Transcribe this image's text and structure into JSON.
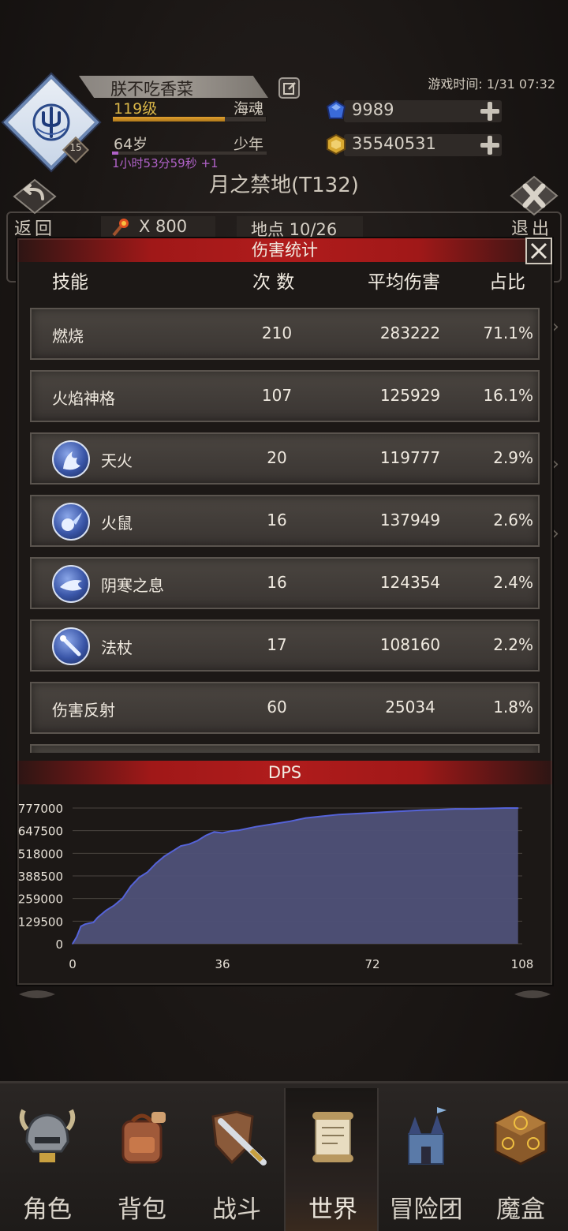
{
  "player": {
    "name": "朕不吃香菜",
    "level": "119级",
    "class": "海魂",
    "age": "64岁",
    "stage": "少年",
    "timer": "1小时53分59秒 +1",
    "rank_badge": "15",
    "exp_progress": 0.73
  },
  "header": {
    "game_time": "游戏时间: 1/31 07:32",
    "gems": "9989",
    "gold": "35540531",
    "map_name": "月之禁地(T132)",
    "back_label": "返回",
    "exit_label": "退出",
    "torch_count": "X 800",
    "location": "地点 10/26"
  },
  "dialog": {
    "title": "伤害统计",
    "columns": {
      "skill": "技能",
      "count": "次 数",
      "avg": "平均伤害",
      "pct": "占比"
    },
    "rows": [
      {
        "name": "燃烧",
        "count": "210",
        "avg": "283222",
        "pct": "71.1%",
        "icon": null
      },
      {
        "name": "火焰神格",
        "count": "107",
        "avg": "125929",
        "pct": "16.1%",
        "icon": null
      },
      {
        "name": "天火",
        "count": "20",
        "avg": "119777",
        "pct": "2.9%",
        "icon": "sky-fire-icon"
      },
      {
        "name": "火鼠",
        "count": "16",
        "avg": "137949",
        "pct": "2.6%",
        "icon": "fire-rat-icon"
      },
      {
        "name": "阴寒之息",
        "count": "16",
        "avg": "124354",
        "pct": "2.4%",
        "icon": "frost-breath-icon"
      },
      {
        "name": "法杖",
        "count": "17",
        "avg": "108160",
        "pct": "2.2%",
        "icon": "staff-icon"
      },
      {
        "name": "伤害反射",
        "count": "60",
        "avg": "25034",
        "pct": "1.8%",
        "icon": null
      }
    ]
  },
  "nav": [
    {
      "label": "角色",
      "icon": "helmet-icon",
      "active": false
    },
    {
      "label": "背包",
      "icon": "backpack-icon",
      "active": false
    },
    {
      "label": "战斗",
      "icon": "sword-shield-icon",
      "active": false
    },
    {
      "label": "世界",
      "icon": "scroll-icon",
      "active": true
    },
    {
      "label": "冒险团",
      "icon": "castle-icon",
      "active": false
    },
    {
      "label": "魔盒",
      "icon": "magic-box-icon",
      "active": false
    }
  ],
  "colors": {
    "accent_red": "#b01c1c",
    "chart_fill": "#4f5178",
    "chart_line": "#5563d8",
    "gold": "#d9b648",
    "purple": "#b062c8"
  },
  "chart_data": {
    "type": "area",
    "title": "DPS",
    "xlabel": "",
    "ylabel": "",
    "xlim": [
      0,
      108
    ],
    "ylim": [
      0,
      777000
    ],
    "x_ticks": [
      "0",
      "36",
      "72",
      "108"
    ],
    "y_ticks": [
      "0",
      "129500",
      "259000",
      "388500",
      "518000",
      "647500",
      "777000"
    ],
    "grid": true,
    "series": [
      {
        "x": [
          0,
          1,
          2,
          3,
          4,
          5,
          6,
          7,
          8,
          10,
          12,
          14,
          16,
          18,
          20,
          22,
          24,
          26,
          28,
          30,
          32,
          34,
          36,
          38,
          40,
          44,
          48,
          52,
          56,
          60,
          64,
          68,
          72,
          76,
          80,
          84,
          88,
          92,
          96,
          100,
          104,
          107
        ],
        "y": [
          0,
          40000,
          100000,
          112000,
          118000,
          122000,
          150000,
          170000,
          190000,
          220000,
          260000,
          330000,
          380000,
          410000,
          460000,
          500000,
          530000,
          560000,
          570000,
          590000,
          620000,
          640000,
          635000,
          645000,
          650000,
          670000,
          685000,
          700000,
          720000,
          730000,
          740000,
          745000,
          750000,
          755000,
          760000,
          765000,
          768000,
          772000,
          772000,
          775000,
          777000,
          777000
        ]
      }
    ]
  }
}
